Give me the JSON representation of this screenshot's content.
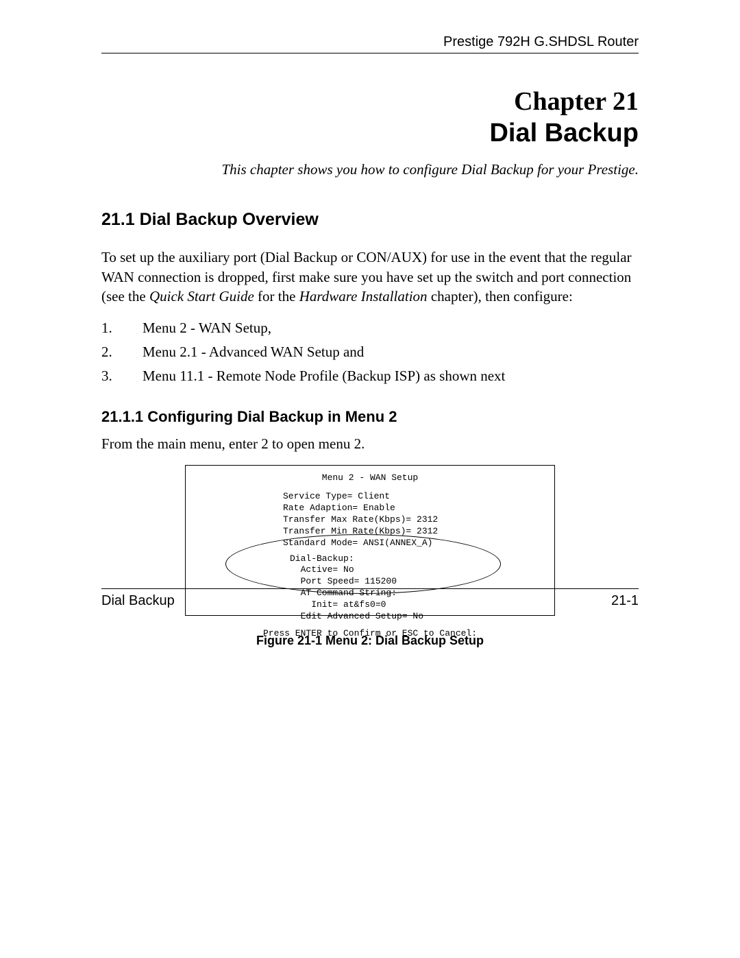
{
  "header": {
    "product": "Prestige 792H G.SHDSL Router"
  },
  "chapter": {
    "chap_line": "Chapter 21",
    "title": "Dial Backup",
    "intro": "This chapter shows you how to configure Dial Backup for your Prestige."
  },
  "section": {
    "num_title": "21.1  Dial Backup Overview",
    "para_pre": "To set up the auxiliary port (Dial Backup or CON/AUX) for use in the event that the regular WAN connection is dropped, first make sure you have set up the switch and port connection (see the ",
    "para_ital1": "Quick Start Guide",
    "para_mid": " for the ",
    "para_ital2": "Hardware Installation",
    "para_post": " chapter), then configure:",
    "items": [
      {
        "n": "1.",
        "t": "Menu 2 - WAN Setup,"
      },
      {
        "n": "2.",
        "t": "Menu 2.1 - Advanced WAN Setup and"
      },
      {
        "n": "3.",
        "t": "Menu 11.1 - Remote Node Profile (Backup ISP) as shown next"
      }
    ]
  },
  "subsection": {
    "title": "21.1.1 Configuring Dial Backup in Menu 2",
    "para": "From the main menu, enter 2 to open menu 2."
  },
  "terminal": {
    "title": "Menu 2 - WAN Setup",
    "lines": "Service Type= Client\nRate Adaption= Enable\nTransfer Max Rate(Kbps)= 2312\nTransfer Min Rate(Kbps)= 2312\nStandard Mode= ANSI(ANNEX_A)",
    "dial": "Dial-Backup:\n  Active= No\n  Port Speed= 115200\n  AT Command String:\n    Init= at&fs0=0\n  Edit Advanced Setup= No",
    "confirm": "Press ENTER to Confirm or ESC to Cancel:"
  },
  "figure": {
    "caption": "Figure 21-1 Menu 2: Dial Backup Setup"
  },
  "footer": {
    "left": "Dial Backup",
    "right": "21-1"
  }
}
